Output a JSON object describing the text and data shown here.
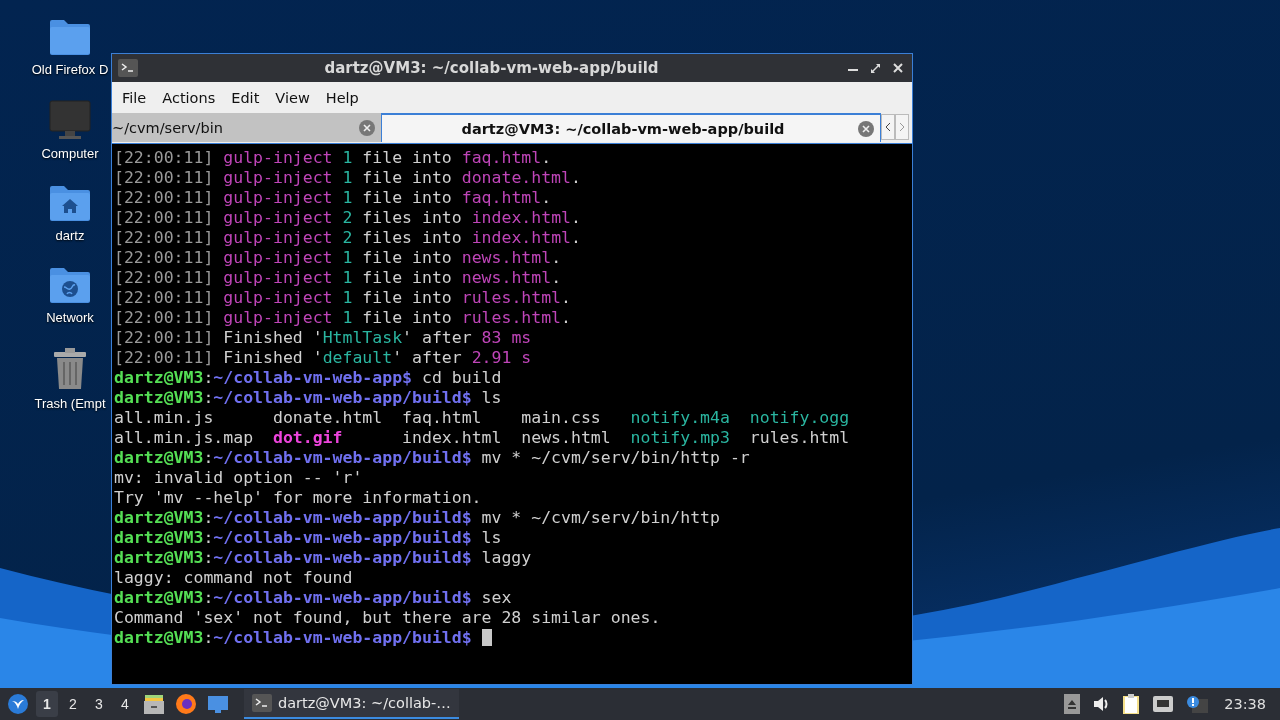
{
  "desktop_icons": [
    {
      "kind": "folder",
      "label": "Old Firefox D"
    },
    {
      "kind": "computer",
      "label": "Computer"
    },
    {
      "kind": "home",
      "label": "dartz"
    },
    {
      "kind": "network",
      "label": "Network"
    },
    {
      "kind": "trash",
      "label": "Trash (Empt"
    }
  ],
  "window": {
    "title": "dartz@VM3: ~/collab-vm-web-app/build",
    "menu": [
      "File",
      "Actions",
      "Edit",
      "View",
      "Help"
    ],
    "tabs": [
      {
        "label": "~/cvm/serv/bin",
        "selected": false
      },
      {
        "label": "dartz@VM3: ~/collab-vm-web-app/build",
        "selected": true
      }
    ],
    "terminal": [
      {
        "segments": [
          {
            "text": "[22:00:11] ",
            "kind": "dim"
          },
          {
            "text": "gulp-inject ",
            "kind": "magenta"
          },
          {
            "text": "1",
            "kind": "cyan"
          },
          {
            "text": " file into ",
            "kind": "plain"
          },
          {
            "text": "faq.html",
            "kind": "magenta"
          },
          {
            "text": ".",
            "kind": "plain"
          }
        ]
      },
      {
        "segments": [
          {
            "text": "[22:00:11] ",
            "kind": "dim"
          },
          {
            "text": "gulp-inject ",
            "kind": "magenta"
          },
          {
            "text": "1",
            "kind": "cyan"
          },
          {
            "text": " file into ",
            "kind": "plain"
          },
          {
            "text": "donate.html",
            "kind": "magenta"
          },
          {
            "text": ".",
            "kind": "plain"
          }
        ]
      },
      {
        "segments": [
          {
            "text": "[22:00:11] ",
            "kind": "dim"
          },
          {
            "text": "gulp-inject ",
            "kind": "magenta"
          },
          {
            "text": "1",
            "kind": "cyan"
          },
          {
            "text": " file into ",
            "kind": "plain"
          },
          {
            "text": "faq.html",
            "kind": "magenta"
          },
          {
            "text": ".",
            "kind": "plain"
          }
        ]
      },
      {
        "segments": [
          {
            "text": "[22:00:11] ",
            "kind": "dim"
          },
          {
            "text": "gulp-inject ",
            "kind": "magenta"
          },
          {
            "text": "2",
            "kind": "cyan"
          },
          {
            "text": " files into ",
            "kind": "plain"
          },
          {
            "text": "index.html",
            "kind": "magenta"
          },
          {
            "text": ".",
            "kind": "plain"
          }
        ]
      },
      {
        "segments": [
          {
            "text": "[22:00:11] ",
            "kind": "dim"
          },
          {
            "text": "gulp-inject ",
            "kind": "magenta"
          },
          {
            "text": "2",
            "kind": "cyan"
          },
          {
            "text": " files into ",
            "kind": "plain"
          },
          {
            "text": "index.html",
            "kind": "magenta"
          },
          {
            "text": ".",
            "kind": "plain"
          }
        ]
      },
      {
        "segments": [
          {
            "text": "[22:00:11] ",
            "kind": "dim"
          },
          {
            "text": "gulp-inject ",
            "kind": "magenta"
          },
          {
            "text": "1",
            "kind": "cyan"
          },
          {
            "text": " file into ",
            "kind": "plain"
          },
          {
            "text": "news.html",
            "kind": "magenta"
          },
          {
            "text": ".",
            "kind": "plain"
          }
        ]
      },
      {
        "segments": [
          {
            "text": "[22:00:11] ",
            "kind": "dim"
          },
          {
            "text": "gulp-inject ",
            "kind": "magenta"
          },
          {
            "text": "1",
            "kind": "cyan"
          },
          {
            "text": " file into ",
            "kind": "plain"
          },
          {
            "text": "news.html",
            "kind": "magenta"
          },
          {
            "text": ".",
            "kind": "plain"
          }
        ]
      },
      {
        "segments": [
          {
            "text": "[22:00:11] ",
            "kind": "dim"
          },
          {
            "text": "gulp-inject ",
            "kind": "magenta"
          },
          {
            "text": "1",
            "kind": "cyan"
          },
          {
            "text": " file into ",
            "kind": "plain"
          },
          {
            "text": "rules.html",
            "kind": "magenta"
          },
          {
            "text": ".",
            "kind": "plain"
          }
        ]
      },
      {
        "segments": [
          {
            "text": "[22:00:11] ",
            "kind": "dim"
          },
          {
            "text": "gulp-inject ",
            "kind": "magenta"
          },
          {
            "text": "1",
            "kind": "cyan"
          },
          {
            "text": " file into ",
            "kind": "plain"
          },
          {
            "text": "rules.html",
            "kind": "magenta"
          },
          {
            "text": ".",
            "kind": "plain"
          }
        ]
      },
      {
        "segments": [
          {
            "text": "[22:00:11] ",
            "kind": "dim"
          },
          {
            "text": "Finished '",
            "kind": "plain"
          },
          {
            "text": "HtmlTask",
            "kind": "cyan"
          },
          {
            "text": "' after ",
            "kind": "plain"
          },
          {
            "text": "83 ms",
            "kind": "magenta"
          }
        ]
      },
      {
        "segments": [
          {
            "text": "[22:00:11] ",
            "kind": "dim"
          },
          {
            "text": "Finished '",
            "kind": "plain"
          },
          {
            "text": "default",
            "kind": "cyan"
          },
          {
            "text": "' after ",
            "kind": "plain"
          },
          {
            "text": "2.91 s",
            "kind": "magenta"
          }
        ]
      },
      {
        "segments": [
          {
            "text": "dartz@VM3",
            "kind": "user"
          },
          {
            "text": ":",
            "kind": "plain"
          },
          {
            "text": "~/collab-vm-web-app$",
            "kind": "path"
          },
          {
            "text": " cd build",
            "kind": "plain"
          }
        ]
      },
      {
        "segments": [
          {
            "text": "dartz@VM3",
            "kind": "user"
          },
          {
            "text": ":",
            "kind": "plain"
          },
          {
            "text": "~/collab-vm-web-app/build$",
            "kind": "path"
          },
          {
            "text": " ls",
            "kind": "plain"
          }
        ]
      },
      {
        "segments": [
          {
            "text": "all.min.js      donate.html  faq.html    main.css   ",
            "kind": "plain"
          },
          {
            "text": "notify.m4a",
            "kind": "cyan"
          },
          {
            "text": "  notify.ogg",
            "kind": "cyan"
          }
        ]
      },
      {
        "segments": [
          {
            "text": "all.min.js.map  ",
            "kind": "plain"
          },
          {
            "text": "dot.gif",
            "kind": "bold-magenta"
          },
          {
            "text": "      index.html  news.html  ",
            "kind": "plain"
          },
          {
            "text": "notify.mp3",
            "kind": "cyan"
          },
          {
            "text": "  rules.html",
            "kind": "plain"
          }
        ]
      },
      {
        "segments": [
          {
            "text": "dartz@VM3",
            "kind": "user"
          },
          {
            "text": ":",
            "kind": "plain"
          },
          {
            "text": "~/collab-vm-web-app/build$",
            "kind": "path"
          },
          {
            "text": " mv * ~/cvm/serv/bin/http -r",
            "kind": "plain"
          }
        ]
      },
      {
        "segments": [
          {
            "text": "mv: invalid option -- 'r'",
            "kind": "plain"
          }
        ]
      },
      {
        "segments": [
          {
            "text": "Try 'mv --help' for more information.",
            "kind": "plain"
          }
        ]
      },
      {
        "segments": [
          {
            "text": "dartz@VM3",
            "kind": "user"
          },
          {
            "text": ":",
            "kind": "plain"
          },
          {
            "text": "~/collab-vm-web-app/build$",
            "kind": "path"
          },
          {
            "text": " mv * ~/cvm/serv/bin/http",
            "kind": "plain"
          }
        ]
      },
      {
        "segments": [
          {
            "text": "dartz@VM3",
            "kind": "user"
          },
          {
            "text": ":",
            "kind": "plain"
          },
          {
            "text": "~/collab-vm-web-app/build$",
            "kind": "path"
          },
          {
            "text": " ls",
            "kind": "plain"
          }
        ]
      },
      {
        "segments": [
          {
            "text": "dartz@VM3",
            "kind": "user"
          },
          {
            "text": ":",
            "kind": "plain"
          },
          {
            "text": "~/collab-vm-web-app/build$",
            "kind": "path"
          },
          {
            "text": " laggy",
            "kind": "plain"
          }
        ]
      },
      {
        "segments": [
          {
            "text": "laggy: command not found",
            "kind": "plain"
          }
        ]
      },
      {
        "segments": [
          {
            "text": "dartz@VM3",
            "kind": "user"
          },
          {
            "text": ":",
            "kind": "plain"
          },
          {
            "text": "~/collab-vm-web-app/build$",
            "kind": "path"
          },
          {
            "text": " sex",
            "kind": "plain"
          }
        ]
      },
      {
        "segments": [
          {
            "text": "Command 'sex' not found, but there are 28 similar ones.",
            "kind": "plain"
          }
        ]
      },
      {
        "segments": [
          {
            "text": "dartz@VM3",
            "kind": "user"
          },
          {
            "text": ":",
            "kind": "plain"
          },
          {
            "text": "~/collab-vm-web-app/build$",
            "kind": "path"
          }
        ],
        "cursor": true
      }
    ]
  },
  "taskbar": {
    "workspaces": [
      {
        "label": "1",
        "selected": true
      },
      {
        "label": "2",
        "selected": false
      },
      {
        "label": "3",
        "selected": false
      },
      {
        "label": "4",
        "selected": false
      }
    ],
    "tasks": [
      {
        "label": "dartz@VM3: ~/collab-…",
        "selected": true
      }
    ],
    "clock": "23:38"
  }
}
